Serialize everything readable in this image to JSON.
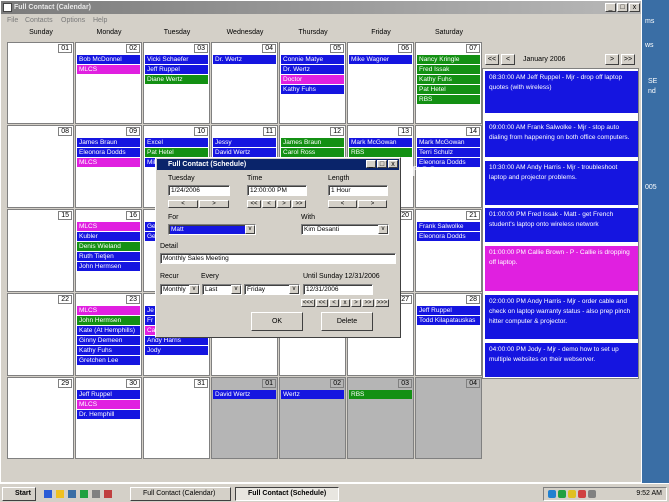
{
  "window": {
    "title": "Full Contact (Calendar)",
    "controls": [
      "_",
      "□",
      "x"
    ]
  },
  "menu": [
    "File",
    "Contacts",
    "Options",
    "Help"
  ],
  "weekdays": [
    "Sunday",
    "Monday",
    "Tuesday",
    "Wednesday",
    "Thursday",
    "Friday",
    "Saturday"
  ],
  "weeks": [
    [
      {
        "num": "01",
        "gray": false,
        "events": []
      },
      {
        "num": "02",
        "gray": false,
        "events": [
          {
            "t": "Bob McDonnel",
            "c": "blue"
          },
          {
            "t": "MLCS",
            "c": "mag"
          }
        ]
      },
      {
        "num": "03",
        "gray": false,
        "events": [
          {
            "t": "Vicki Schaefer",
            "c": "blue"
          },
          {
            "t": "Jeff Ruppel",
            "c": "blue"
          },
          {
            "t": "Diane Wertz",
            "c": "grn"
          }
        ]
      },
      {
        "num": "04",
        "gray": false,
        "events": [
          {
            "t": "Dr. Wertz",
            "c": "blue"
          }
        ]
      },
      {
        "num": "05",
        "gray": false,
        "events": [
          {
            "t": "Connie Matye",
            "c": "blue"
          },
          {
            "t": "Dr. Wertz",
            "c": "blue"
          },
          {
            "t": "Doctor",
            "c": "mag"
          },
          {
            "t": "Kathy Fuhs",
            "c": "blue"
          }
        ]
      },
      {
        "num": "06",
        "gray": false,
        "events": [
          {
            "t": "Mike Wagner",
            "c": "blue"
          }
        ]
      },
      {
        "num": "07",
        "gray": false,
        "events": [
          {
            "t": "Nancy Kringle",
            "c": "grn"
          },
          {
            "t": "Fred Issak",
            "c": "grn"
          },
          {
            "t": "Kathy Fuhs",
            "c": "grn"
          },
          {
            "t": "Pat Hetel",
            "c": "grn"
          },
          {
            "t": "RBS",
            "c": "grn"
          }
        ]
      }
    ],
    [
      {
        "num": "08",
        "gray": false,
        "events": []
      },
      {
        "num": "09",
        "gray": false,
        "events": [
          {
            "t": "James Braun",
            "c": "blue"
          },
          {
            "t": "Eleonora Dodds",
            "c": "blue"
          },
          {
            "t": "MLCS",
            "c": "mag"
          }
        ]
      },
      {
        "num": "10",
        "gray": false,
        "events": [
          {
            "t": "Excel",
            "c": "blue"
          },
          {
            "t": "Pat Hetel",
            "c": "grn"
          },
          {
            "t": "Mike",
            "c": "blue"
          }
        ]
      },
      {
        "num": "11",
        "gray": false,
        "events": [
          {
            "t": "Jessy",
            "c": "blue"
          },
          {
            "t": "David Wertz",
            "c": "blue"
          }
        ]
      },
      {
        "num": "12",
        "gray": false,
        "events": [
          {
            "t": "James Braun",
            "c": "grn"
          },
          {
            "t": "Carol Ross",
            "c": "grn"
          }
        ]
      },
      {
        "num": "13",
        "gray": false,
        "events": [
          {
            "t": "Mark McGowan",
            "c": "blue"
          },
          {
            "t": "RBS",
            "c": "grn"
          }
        ]
      },
      {
        "num": "14",
        "gray": false,
        "events": [
          {
            "t": "Mark McGowan",
            "c": "blue"
          },
          {
            "t": "Terri Schulz",
            "c": "blue"
          },
          {
            "t": "Eleonora Dodds",
            "c": "blue"
          }
        ]
      }
    ],
    [
      {
        "num": "15",
        "gray": false,
        "events": []
      },
      {
        "num": "16",
        "gray": false,
        "events": [
          {
            "t": "MLCS",
            "c": "mag"
          },
          {
            "t": "Kubler",
            "c": "blue"
          },
          {
            "t": "Denis Wieland",
            "c": "grn"
          },
          {
            "t": "Ruth Tietjen",
            "c": "blue"
          },
          {
            "t": "John Hermsen",
            "c": "blue"
          }
        ]
      },
      {
        "num": "17",
        "gray": false,
        "events": [
          {
            "t": "Ge",
            "c": "blue"
          },
          {
            "t": "Ge",
            "c": "blue"
          }
        ]
      },
      {
        "num": "18",
        "gray": false,
        "events": []
      },
      {
        "num": "19",
        "gray": false,
        "events": []
      },
      {
        "num": "20",
        "gray": false,
        "events": []
      },
      {
        "num": "21",
        "gray": false,
        "events": [
          {
            "t": "Frank Salwolke",
            "c": "blue"
          },
          {
            "t": "Eleonora Dodds",
            "c": "blue"
          }
        ]
      }
    ],
    [
      {
        "num": "22",
        "gray": false,
        "events": []
      },
      {
        "num": "23",
        "gray": false,
        "events": [
          {
            "t": "MLCS",
            "c": "mag"
          },
          {
            "t": "John Hermsen",
            "c": "grn"
          },
          {
            "t": "Kate (At Hemphills)",
            "c": "blue"
          },
          {
            "t": "Ginny Demeen",
            "c": "blue"
          },
          {
            "t": "Kathy Fuhs",
            "c": "blue"
          },
          {
            "t": "Gretchen Lee",
            "c": "blue"
          }
        ]
      },
      {
        "num": "24",
        "gray": false,
        "events": [
          {
            "t": "Je",
            "c": "blue"
          },
          {
            "t": "Fr",
            "c": "blue"
          },
          {
            "t": "Callie Brown",
            "c": "mag"
          },
          {
            "t": "Andy Harris",
            "c": "blue"
          },
          {
            "t": "Jody",
            "c": "blue"
          }
        ]
      },
      {
        "num": "25",
        "gray": false,
        "events": []
      },
      {
        "num": "26",
        "gray": false,
        "events": [
          {
            "t": "A",
            "c": "blue"
          },
          {
            "t": "A",
            "c": "blue"
          }
        ]
      },
      {
        "num": "27",
        "gray": false,
        "events": []
      },
      {
        "num": "28",
        "gray": false,
        "events": [
          {
            "t": "Jeff Ruppel",
            "c": "blue"
          },
          {
            "t": "Todd Kilapatauskas",
            "c": "blue"
          }
        ]
      }
    ],
    [
      {
        "num": "29",
        "gray": false,
        "events": []
      },
      {
        "num": "30",
        "gray": false,
        "events": [
          {
            "t": "Jeff Ruppel",
            "c": "blue"
          },
          {
            "t": "MLCS",
            "c": "mag"
          },
          {
            "t": "Dr. Hemphill",
            "c": "blue"
          }
        ]
      },
      {
        "num": "31",
        "gray": false,
        "events": []
      },
      {
        "num": "01",
        "gray": true,
        "events": [
          {
            "t": "David Wertz",
            "c": "blue"
          }
        ]
      },
      {
        "num": "02",
        "gray": true,
        "events": [
          {
            "t": "Wertz",
            "c": "blue"
          }
        ]
      },
      {
        "num": "03",
        "gray": true,
        "events": [
          {
            "t": "RBS",
            "c": "grn"
          }
        ]
      },
      {
        "num": "04",
        "gray": true,
        "events": []
      }
    ]
  ],
  "mini_nav": {
    "month": "January 2006",
    "prev2": "<<",
    "prev": "<",
    "next": ">",
    "next2": ">>"
  },
  "day_events": [
    {
      "t": "08:30:00 AM Jeff Ruppel - Mjr - drop off laptop quotes (with wireless)",
      "c": "blue"
    },
    {
      "t": "09:00:00 AM Frank Salwolke - Mjr - stop auto dialing from happening on both office computers.",
      "c": "blue"
    },
    {
      "t": "10:30:00 AM Andy Harris - Mjr - troubleshoot laptop and projector problems.",
      "c": "blue"
    },
    {
      "t": "01:00:00 PM Fred Issak - Matt - get French student's laptop onto wireless network",
      "c": "blue"
    },
    {
      "t": "01:00:00 PM Callie Brown - P - Callie is dropping off laptop.",
      "c": "mag"
    },
    {
      "t": "02:00:00 PM Andy Harris - Mjr - order cable and check on laptop warranty status - also prep pinch hitter computer & projector.",
      "c": "blue"
    },
    {
      "t": "04:00:00 PM Jody - Mjr - demo how to set up multiple websites on their webserver.",
      "c": "blue"
    }
  ],
  "dialog": {
    "title": "Full Contact (Schedule)",
    "date_label": "Tuesday",
    "date_value": "1/24/2006",
    "time_label": "Time",
    "time_value": "12:00:00 PM",
    "length_label": "Length",
    "length_value": "1 Hour",
    "for_label": "For",
    "for_value": "Matt",
    "with_label": "With",
    "with_value": "Kim Desanti",
    "detail_label": "Detail",
    "detail_value": "Monthly Sales Meeting",
    "recur_label": "Recur",
    "recur_value": "Monthly",
    "every_label": "Every",
    "every_value": "Last",
    "day_value": "Friday",
    "until_label": "Until Sunday 12/31/2006",
    "until_value": "12/31/2006",
    "ok_label": "OK",
    "delete_label": "Delete"
  },
  "watermark": "soft32.com",
  "desktop_labels": [
    "ms",
    "ws",
    "SE",
    "nd",
    "005"
  ],
  "taskbar": {
    "start": "Start",
    "tasks": [
      "Full Contact (Calendar)",
      "Full Contact (Schedule)"
    ],
    "clock": "9:52 AM"
  }
}
